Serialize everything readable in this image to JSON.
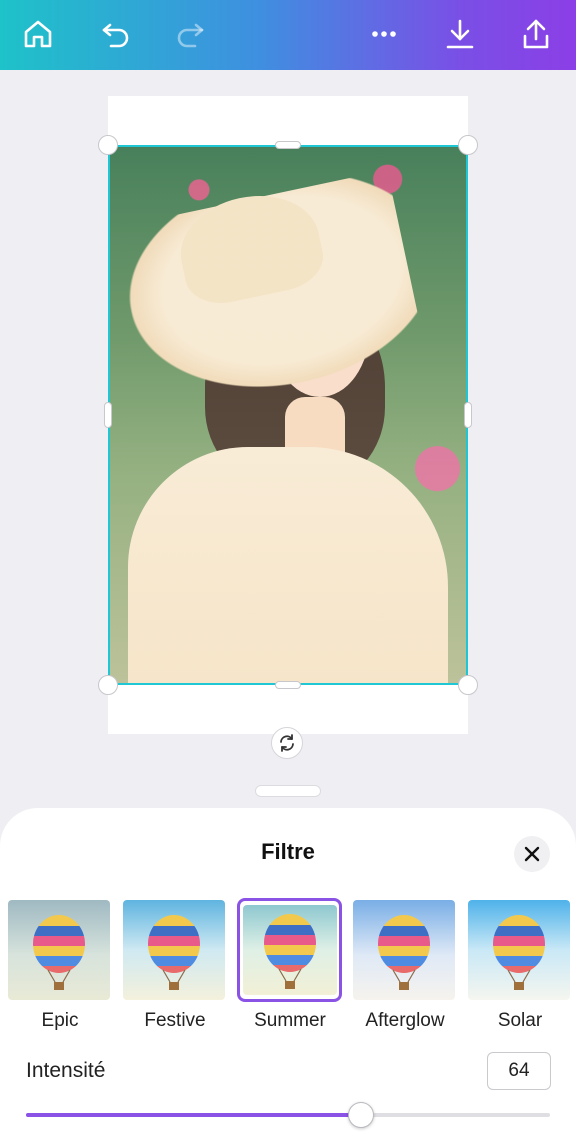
{
  "topbar": {
    "icons": [
      "home-icon",
      "undo-icon",
      "redo-icon",
      "more-icon",
      "download-icon",
      "share-icon"
    ],
    "gradient": [
      "#1ec2c9",
      "#8b3fe6"
    ]
  },
  "canvas": {
    "frame_color": "#1fc7d4",
    "rotate_icon": "rotate-icon"
  },
  "sheet": {
    "title": "Filtre",
    "close_icon": "close-icon",
    "filters": [
      {
        "label": "Epic",
        "selected": false
      },
      {
        "label": "Festive",
        "selected": false
      },
      {
        "label": "Summer",
        "selected": true
      },
      {
        "label": "Afterglow",
        "selected": false
      },
      {
        "label": "Solar",
        "selected": false
      }
    ],
    "intensity": {
      "label": "Intensité",
      "value": "64",
      "fraction": 0.64
    },
    "accent": "#8b52e6"
  }
}
